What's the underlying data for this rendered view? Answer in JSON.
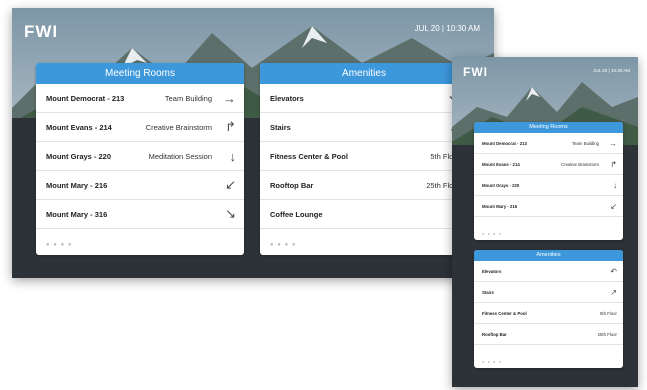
{
  "landscape": {
    "logo": "FWI",
    "clock": "JUL 20 | 10:30 AM",
    "meeting": {
      "title": "Meeting Rooms",
      "rows": [
        {
          "name": "Mount Democrat - 213",
          "sub": "Team Building",
          "arrow": "→"
        },
        {
          "name": "Mount Evans - 214",
          "sub": "Creative Brainstorm",
          "arrow": "↱"
        },
        {
          "name": "Mount Grays - 220",
          "sub": "Meditation Session",
          "arrow": "↓"
        },
        {
          "name": "Mount Mary - 216",
          "sub": "",
          "arrow": "↙"
        },
        {
          "name": "Mount Mary - 316",
          "sub": "",
          "arrow": "↘"
        }
      ],
      "dots": "● ● ● ●"
    },
    "amenities": {
      "title": "Amenities",
      "rows": [
        {
          "name": "Elevators",
          "sub": "",
          "arrow": "↶"
        },
        {
          "name": "Stairs",
          "sub": "",
          "arrow": "↗"
        },
        {
          "name": "Fitness Center & Pool",
          "sub": "5th Floor",
          "arrow": ""
        },
        {
          "name": "Rooftop Bar",
          "sub": "25th Floor",
          "arrow": ""
        },
        {
          "name": "Coffee Lounge",
          "sub": "",
          "arrow": "↑"
        }
      ],
      "dots": "● ● ● ●"
    }
  },
  "portrait": {
    "logo": "FWI",
    "clock": "JUL 20 | 10:30 AM",
    "meeting": {
      "title": "Meeting Rooms",
      "rows": [
        {
          "name": "Mount Democrat - 213",
          "sub": "Team Building",
          "arrow": "→"
        },
        {
          "name": "Mount Evans - 214",
          "sub": "Creative Brainstorm",
          "arrow": "↱"
        },
        {
          "name": "Mount Grays - 220",
          "sub": "",
          "arrow": "↓"
        },
        {
          "name": "Mount Mary - 216",
          "sub": "",
          "arrow": "↙"
        }
      ],
      "dots": "● ● ● ●"
    },
    "amenities": {
      "title": "Amenities",
      "rows": [
        {
          "name": "Elevators",
          "sub": "",
          "arrow": "↶"
        },
        {
          "name": "Stairs",
          "sub": "",
          "arrow": "↗"
        },
        {
          "name": "Fitness Center & Pool",
          "sub": "5th Floor",
          "arrow": ""
        },
        {
          "name": "Rooftop Bar",
          "sub": "25th Floor",
          "arrow": ""
        }
      ],
      "dots": "● ● ● ●"
    }
  },
  "colors": {
    "accent": "#3c97db",
    "screen_bg": "#2b3138",
    "card_bg": "#ffffff"
  }
}
